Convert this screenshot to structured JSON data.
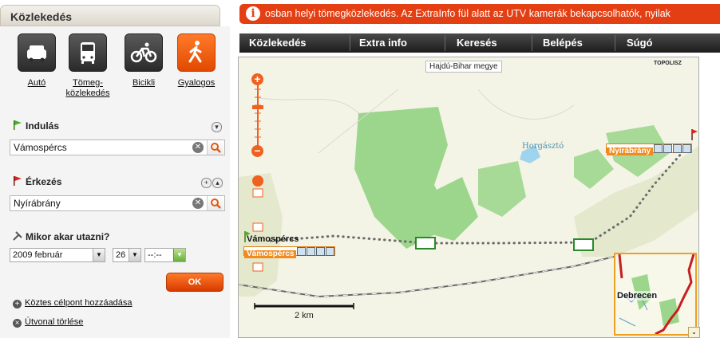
{
  "panel": {
    "title": "Közlekedés",
    "modes": [
      {
        "label": "Autó",
        "icon": "car-icon",
        "active": false
      },
      {
        "label": "Tömeg-\nközlekedés",
        "icon": "bus-icon",
        "active": false
      },
      {
        "label": "Bicikli",
        "icon": "bicycle-icon",
        "active": false
      },
      {
        "label": "Gyalogos",
        "icon": "pedestrian-icon",
        "active": true
      }
    ],
    "start": {
      "label": "Indulás",
      "value": "Vámospércs"
    },
    "dest": {
      "label": "Érkezés",
      "value": "Nyírábrány"
    },
    "when": {
      "label": "Mikor akar utazni?",
      "month": "2009 február",
      "day": "26",
      "time": "--:--"
    },
    "ok": "OK",
    "links": [
      {
        "label": "Köztes célpont hozzáadása",
        "icon": "plus-circle-icon"
      },
      {
        "label": "Útvonal törlése",
        "icon": "x-circle-icon"
      }
    ]
  },
  "banner": {
    "text": "osban helyi tömegközlekedés. Az ExtraInfo fül alatt az UTV kamerák bekapcsolhatók, nyilak"
  },
  "nav": [
    "Közlekedés",
    "Extra info",
    "Keresés",
    "Belépés",
    "Súgó"
  ],
  "map": {
    "county": "Hajdú-Bihar megye",
    "lake": "Horgásztó",
    "start_marker": "Vámospércs",
    "start_place": "Vámospércs",
    "end_marker": "Nyírábrány",
    "scale": "2 km",
    "overview_label": "Debrecen",
    "brand": "TOPOLISZ",
    "route_color": "#6b6b6b",
    "accent": "#f06020",
    "forest_color": "#8fcf83"
  }
}
